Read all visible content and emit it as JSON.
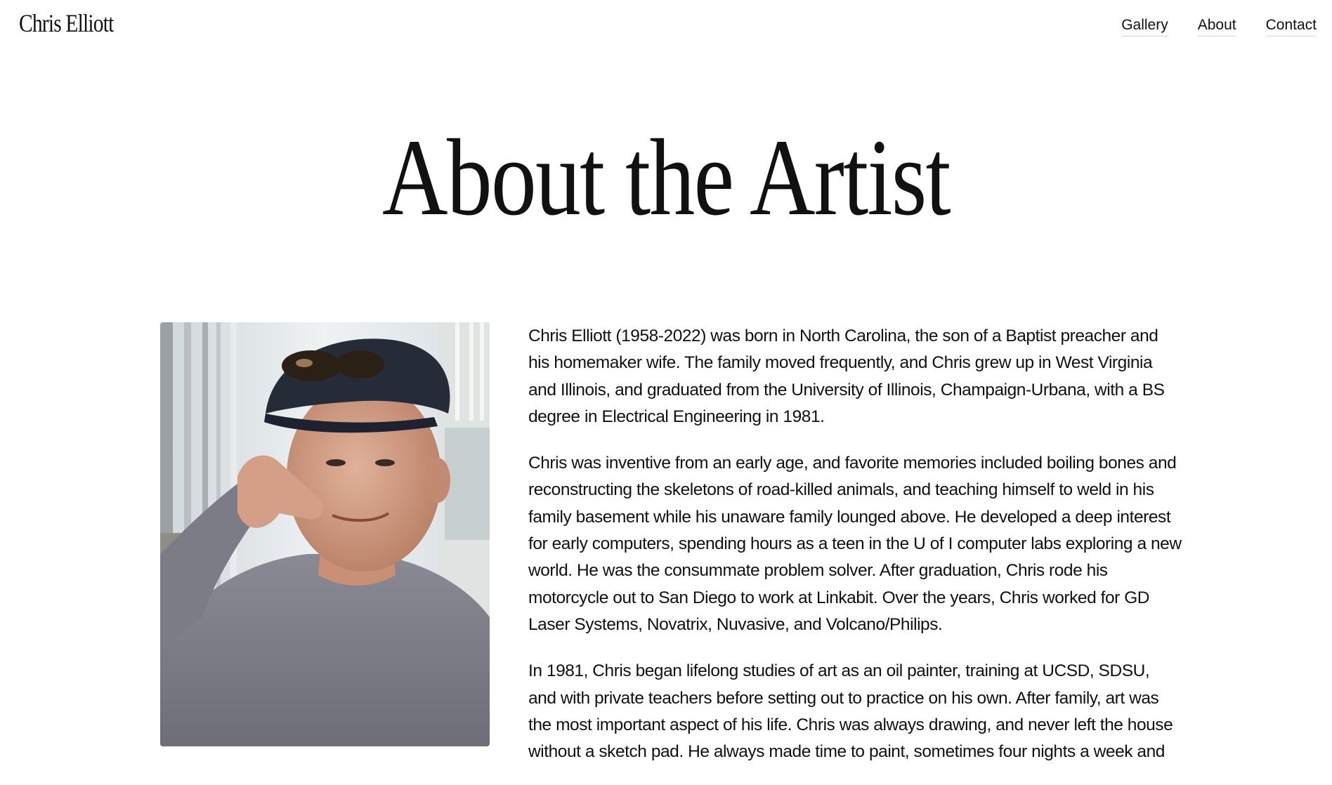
{
  "header": {
    "logo": "Chris Elliott",
    "nav": [
      "Gallery",
      "About",
      "Contact"
    ]
  },
  "main": {
    "title": "About the Artist",
    "paragraphs": [
      "Chris Elliott (1958-2022) was born in North Carolina, the son of a Baptist preacher and his homemaker wife. The family moved frequently, and Chris grew up in West Virginia and Illinois, and graduated from the University of Illinois, Champaign-Urbana, with a BS degree in Electrical Engineering in 1981.",
      "Chris was inventive from an early age, and favorite memories included boiling bones and reconstructing the skeletons of road-killed animals, and teaching himself to weld in his family basement while his unaware family lounged above. He developed a deep interest for early computers, spending hours as a teen in the U of I computer labs exploring a new world. He was the consummate problem solver. After graduation, Chris rode his motorcycle out to San Diego to work at Linkabit. Over the years, Chris worked for GD Laser Systems, Novatrix, Nuvasive, and Volcano/Philips.",
      "In 1981, Chris began lifelong studies of art as an oil painter, training at UCSD, SDSU, and with private teachers before setting out to practice on his own. After family, art was the most important aspect of his life. Chris was always drawing, and never left the house without a sketch pad. He always made time to paint, sometimes four nights a week and"
    ]
  }
}
